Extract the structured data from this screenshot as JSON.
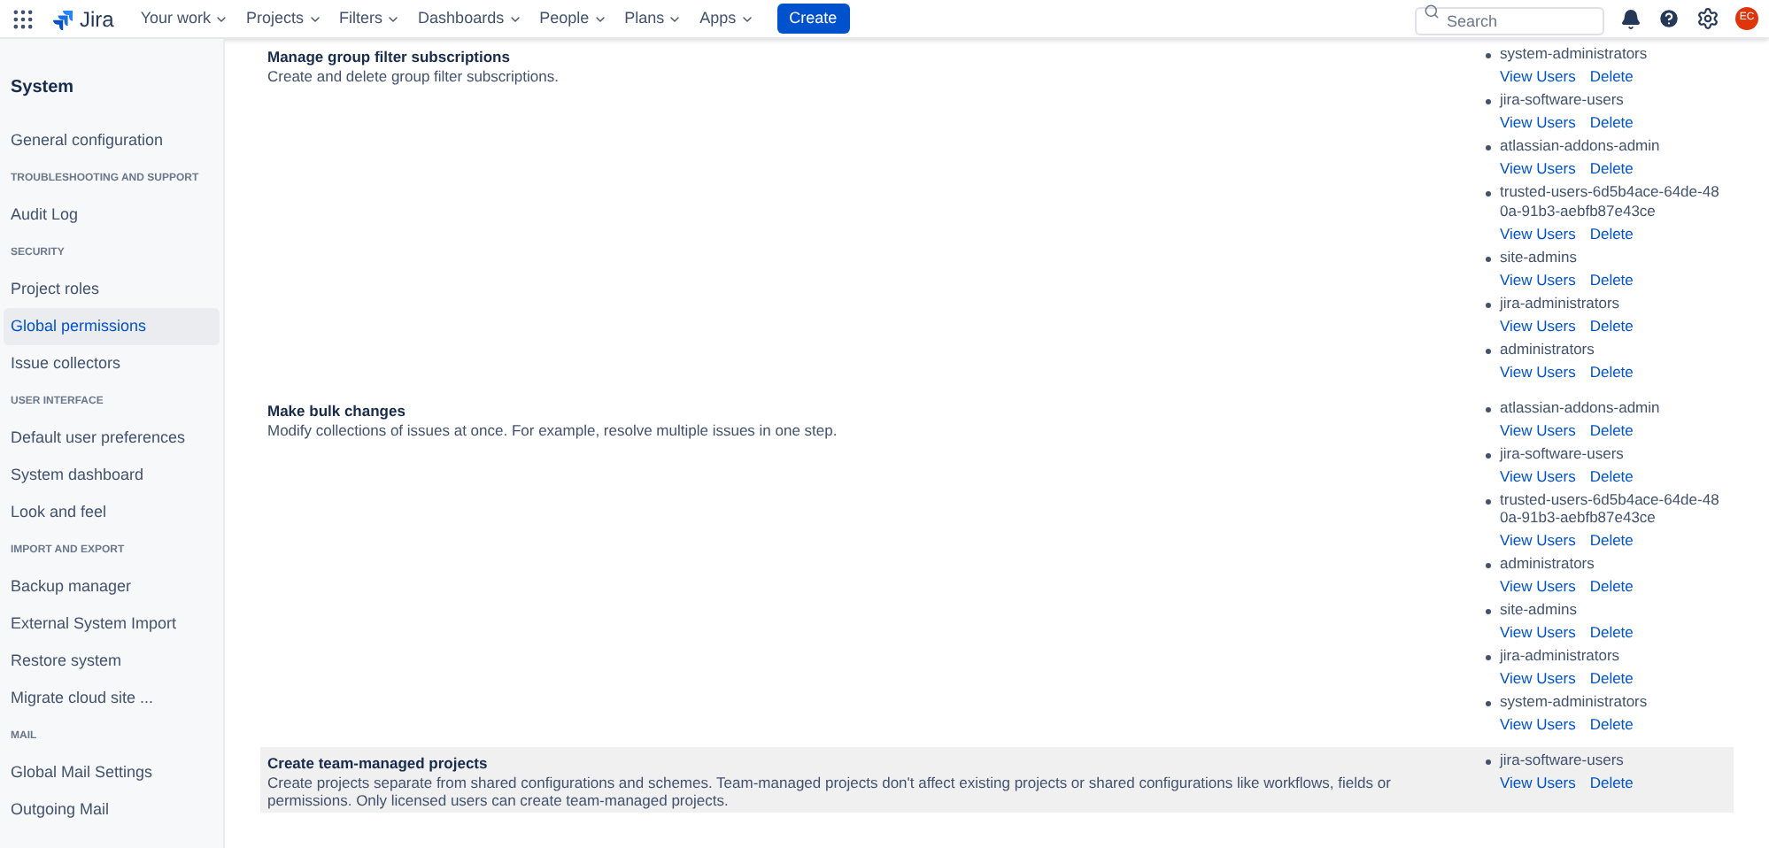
{
  "header": {
    "logo": "Jira",
    "nav": [
      {
        "label": "Your work"
      },
      {
        "label": "Projects"
      },
      {
        "label": "Filters"
      },
      {
        "label": "Dashboards"
      },
      {
        "label": "People"
      },
      {
        "label": "Plans"
      },
      {
        "label": "Apps"
      }
    ],
    "create": "Create",
    "search": {
      "placeholder": "Search"
    },
    "avatar": "EC"
  },
  "sidebar": {
    "title": "System",
    "sections": [
      {
        "items": [
          {
            "label": "General configuration",
            "selected": false
          }
        ]
      },
      {
        "heading": "TROUBLESHOOTING AND SUPPORT",
        "items": [
          {
            "label": "Audit Log",
            "selected": false
          }
        ]
      },
      {
        "heading": "SECURITY",
        "items": [
          {
            "label": "Project roles",
            "selected": false
          },
          {
            "label": "Global permissions",
            "selected": true
          },
          {
            "label": "Issue collectors",
            "selected": false
          }
        ]
      },
      {
        "heading": "USER INTERFACE",
        "items": [
          {
            "label": "Default user preferences",
            "selected": false
          },
          {
            "label": "System dashboard",
            "selected": false
          },
          {
            "label": "Look and feel",
            "selected": false
          }
        ]
      },
      {
        "heading": "IMPORT AND EXPORT",
        "items": [
          {
            "label": "Backup manager",
            "selected": false
          },
          {
            "label": "External System Import",
            "selected": false
          },
          {
            "label": "Restore system",
            "selected": false
          },
          {
            "label": "Migrate cloud site ...",
            "selected": false
          }
        ]
      },
      {
        "heading": "MAIL",
        "items": [
          {
            "label": "Global Mail Settings",
            "selected": false
          },
          {
            "label": "Outgoing Mail",
            "selected": false
          }
        ]
      }
    ]
  },
  "permissions": [
    {
      "title": "Manage group filter subscriptions",
      "description": "Create and delete group filter subscriptions.",
      "highlighted": false,
      "groups": [
        {
          "name": "system-administrators",
          "actions": [
            "View Users",
            "Delete"
          ]
        },
        {
          "name": "jira-software-users",
          "actions": [
            "View Users",
            "Delete"
          ]
        },
        {
          "name": "atlassian-addons-admin",
          "actions": [
            "View Users",
            "Delete"
          ]
        },
        {
          "name": "trusted-users-6d5b4ace-64de-480a-91b3-aebfb87e43ce",
          "actions": [
            "View Users",
            "Delete"
          ]
        },
        {
          "name": "site-admins",
          "actions": [
            "View Users",
            "Delete"
          ]
        },
        {
          "name": "jira-administrators",
          "actions": [
            "View Users",
            "Delete"
          ]
        },
        {
          "name": "administrators",
          "actions": [
            "View Users",
            "Delete"
          ]
        }
      ]
    },
    {
      "title": "Make bulk changes",
      "description": "Modify collections of issues at once. For example, resolve multiple issues in one step.",
      "highlighted": false,
      "groups": [
        {
          "name": "atlassian-addons-admin",
          "actions": [
            "View Users",
            "Delete"
          ]
        },
        {
          "name": "jira-software-users",
          "actions": [
            "View Users",
            "Delete"
          ]
        },
        {
          "name": "trusted-users-6d5b4ace-64de-480a-91b3-aebfb87e43ce",
          "actions": [
            "View Users",
            "Delete"
          ]
        },
        {
          "name": "administrators",
          "actions": [
            "View Users",
            "Delete"
          ]
        },
        {
          "name": "site-admins",
          "actions": [
            "View Users",
            "Delete"
          ]
        },
        {
          "name": "jira-administrators",
          "actions": [
            "View Users",
            "Delete"
          ]
        },
        {
          "name": "system-administrators",
          "actions": [
            "View Users",
            "Delete"
          ]
        }
      ]
    },
    {
      "title": "Create team-managed projects",
      "description": "Create projects separate from shared configurations and schemes. Team-managed projects don't affect existing projects or shared configurations like workflows, fields or permissions. Only licensed users can create team-managed projects.",
      "highlighted": true,
      "groups": [
        {
          "name": "jira-software-users",
          "actions": [
            "View Users",
            "Delete"
          ]
        }
      ]
    }
  ]
}
